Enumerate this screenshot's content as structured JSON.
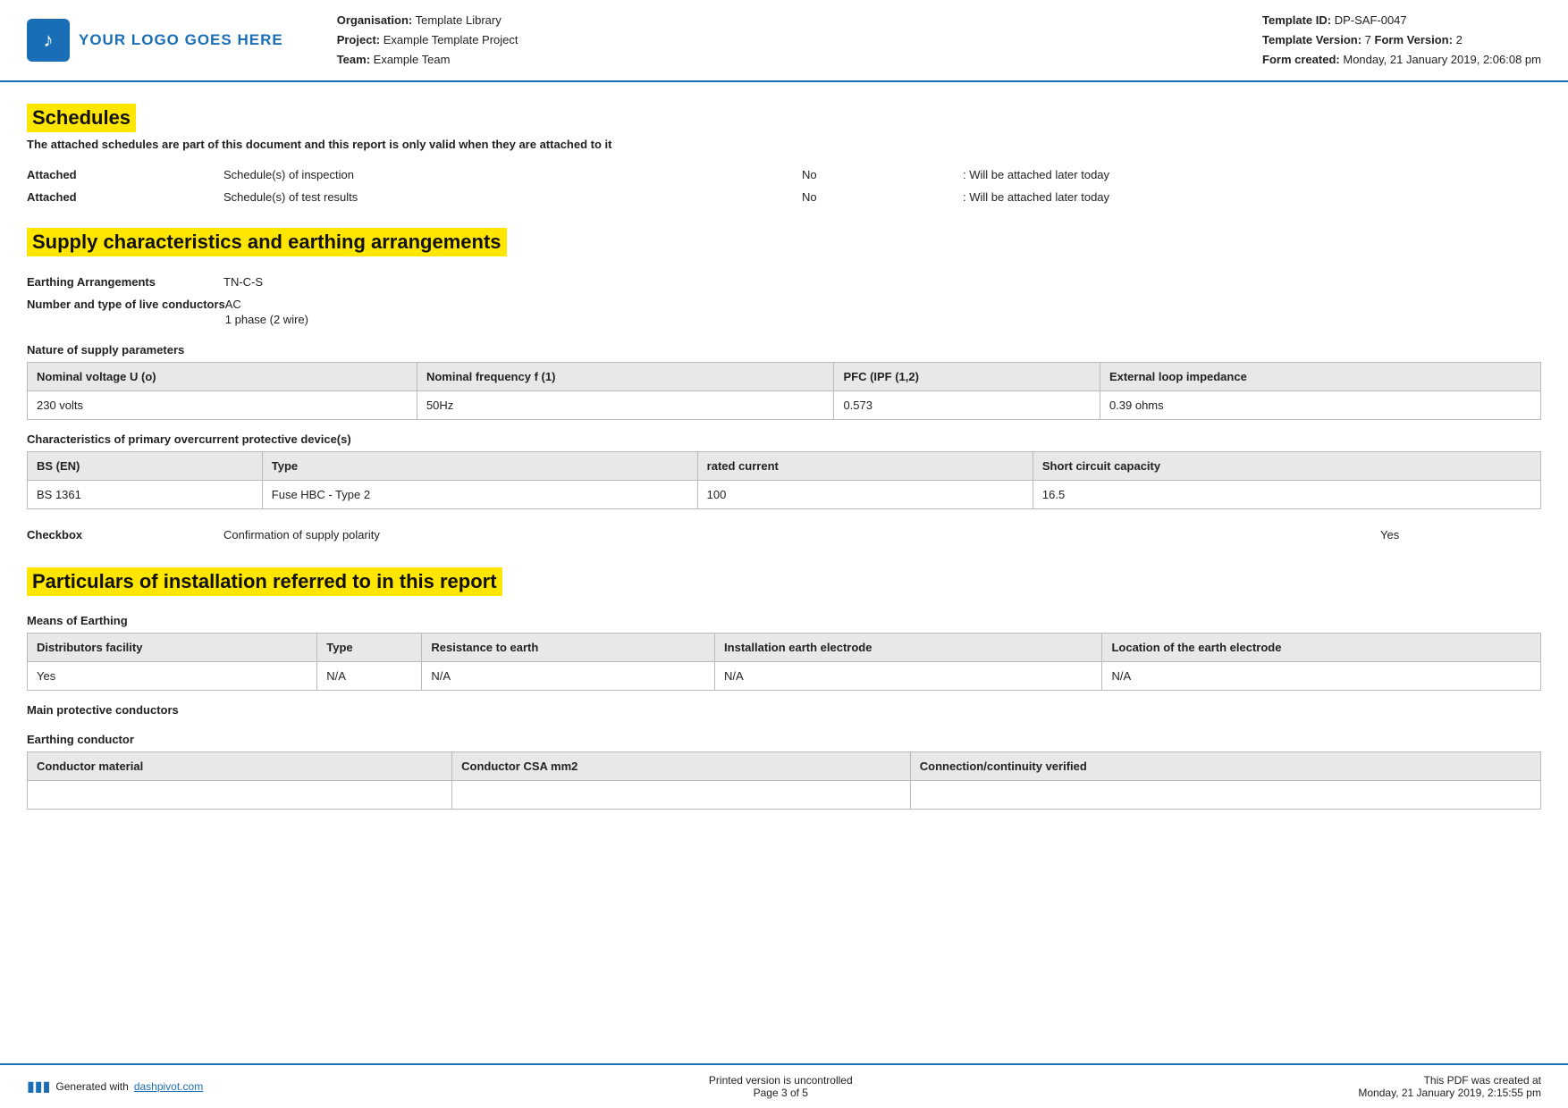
{
  "header": {
    "logo_text": "YOUR LOGO GOES HERE",
    "org_label": "Organisation:",
    "org_value": "Template Library",
    "project_label": "Project:",
    "project_value": "Example Template Project",
    "team_label": "Team:",
    "team_value": "Example Team",
    "template_id_label": "Template ID:",
    "template_id_value": "DP-SAF-0047",
    "template_version_label": "Template Version:",
    "template_version_value": "7",
    "form_version_label": "Form Version:",
    "form_version_value": "2",
    "form_created_label": "Form created:",
    "form_created_value": "Monday, 21 January 2019, 2:06:08 pm"
  },
  "schedules": {
    "title": "Schedules",
    "subtitle": "The attached schedules are part of this document and this report is only valid when they are attached to it",
    "rows": [
      {
        "label": "Attached",
        "description": "Schedule(s) of inspection",
        "status": "No",
        "note": ": Will be attached later today"
      },
      {
        "label": "Attached",
        "description": "Schedule(s) of test results",
        "status": "No",
        "note": ": Will be attached later today"
      }
    ]
  },
  "supply": {
    "title": "Supply characteristics and earthing arrangements",
    "earthing_label": "Earthing Arrangements",
    "earthing_value": "TN-C-S",
    "conductors_label": "Number and type of live conductors",
    "conductors_value1": "AC",
    "conductors_value2": "1 phase (2 wire)",
    "nature_label": "Nature of supply parameters",
    "supply_table": {
      "headers": [
        "Nominal voltage U (o)",
        "Nominal frequency f (1)",
        "PFC (IPF (1,2)",
        "External loop impedance"
      ],
      "rows": [
        [
          "230 volts",
          "50Hz",
          "0.573",
          "0.39 ohms"
        ]
      ]
    },
    "overcurrent_label": "Characteristics of primary overcurrent protective device(s)",
    "overcurrent_table": {
      "headers": [
        "BS (EN)",
        "Type",
        "rated current",
        "Short circuit capacity"
      ],
      "rows": [
        [
          "BS 1361",
          "Fuse HBC - Type 2",
          "100",
          "16.5"
        ]
      ]
    },
    "checkbox_label": "Checkbox",
    "checkbox_description": "Confirmation of supply polarity",
    "checkbox_value": "Yes"
  },
  "particulars": {
    "title": "Particulars of installation referred to in this report",
    "means_label": "Means of Earthing",
    "means_table": {
      "headers": [
        "Distributors facility",
        "Type",
        "Resistance to earth",
        "Installation earth electrode",
        "Location of the earth electrode"
      ],
      "rows": [
        [
          "Yes",
          "N/A",
          "N/A",
          "N/A",
          "N/A"
        ]
      ]
    },
    "main_conductors_label": "Main protective conductors",
    "earthing_conductor_label": "Earthing conductor",
    "earthing_conductor_table": {
      "headers": [
        "Conductor material",
        "Conductor CSA mm2",
        "Connection/continuity verified"
      ],
      "rows": []
    }
  },
  "footer": {
    "generated_label": "Generated with",
    "link_text": "dashpivot.com",
    "uncontrolled_label": "Printed version is uncontrolled",
    "page_label": "Page 3 of 5",
    "created_label": "This PDF was created at",
    "created_value": "Monday, 21 January 2019, 2:15:55 pm"
  }
}
